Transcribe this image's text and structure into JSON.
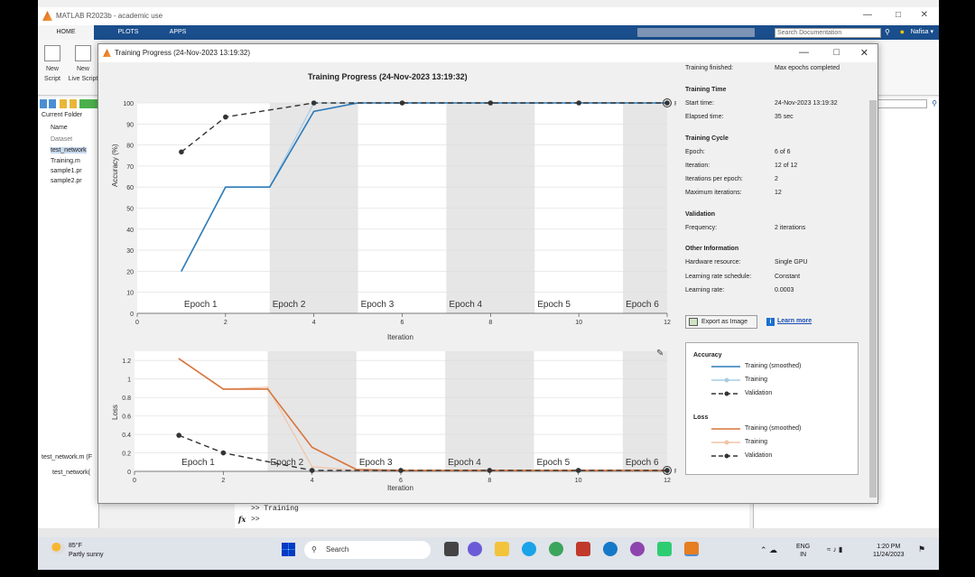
{
  "matlab": {
    "window_title": "MATLAB R2023b - academic use",
    "ribbon_tabs": [
      "HOME",
      "PLOTS",
      "APPS"
    ],
    "search_placeholder": "Search Documentation",
    "user": "Nafisa ▾",
    "new_script": "New",
    "new_script_2": "Script",
    "new_live": "New",
    "new_live_2": "Live Script",
    "current_folder": "Current Folder",
    "folder_name_header": "Name",
    "files": [
      "Dataset",
      "test_network",
      "Training.m",
      "sample1.pr",
      "sample2.pr"
    ],
    "details_file": "test_network.m  (F",
    "details_item": "test_network(",
    "command_line_1": ">> Training",
    "command_prompt": ">>",
    "fx": "fx"
  },
  "training": {
    "window_title": "Training Progress (24-Nov-2023 13:19:32)",
    "plot_title": "Training Progress (24-Nov-2023 13:19:32)",
    "acc_ylabel": "Accuracy (%)",
    "loss_ylabel": "Loss",
    "xlabel": "Iteration",
    "final_label": "Final",
    "epoch_labels": [
      "Epoch 1",
      "Epoch 2",
      "Epoch 3",
      "Epoch 4",
      "Epoch 5",
      "Epoch 6"
    ],
    "info": {
      "finished_label": "Training finished:",
      "finished_value": "Max epochs completed",
      "time_header": "Training Time",
      "start_label": "Start time:",
      "start_value": "24-Nov-2023 13:19:32",
      "elapsed_label": "Elapsed time:",
      "elapsed_value": "35 sec",
      "cycle_header": "Training Cycle",
      "epoch_label": "Epoch:",
      "epoch_value": "6 of 6",
      "iteration_label": "Iteration:",
      "iteration_value": "12 of 12",
      "ipe_label": "Iterations per epoch:",
      "ipe_value": "2",
      "maxit_label": "Maximum iterations:",
      "maxit_value": "12",
      "validation_header": "Validation",
      "freq_label": "Frequency:",
      "freq_value": "2 iterations",
      "other_header": "Other Information",
      "hw_label": "Hardware resource:",
      "hw_value": "Single GPU",
      "lrs_label": "Learning rate schedule:",
      "lrs_value": "Constant",
      "lr_label": "Learning rate:",
      "lr_value": "0.0003"
    },
    "export_label": "Export as Image",
    "learn_more": "Learn more",
    "legend": {
      "acc_header": "Accuracy",
      "loss_header": "Loss",
      "smoothed": "Training (smoothed)",
      "training": "Training",
      "validation": "Validation"
    }
  },
  "chart_data": [
    {
      "type": "line",
      "ylabel": "Accuracy (%)",
      "xlabel": "Iteration",
      "xlim": [
        0,
        12
      ],
      "ylim": [
        0,
        100
      ],
      "xticks": [
        0,
        2,
        4,
        6,
        8,
        10,
        12
      ],
      "yticks": [
        0,
        10,
        20,
        30,
        40,
        50,
        60,
        70,
        80,
        90,
        100
      ],
      "series": [
        {
          "name": "Training (smoothed)",
          "color": "#2b7bba",
          "x": [
            1,
            2,
            3,
            4,
            5,
            6,
            7,
            8,
            9,
            10,
            11,
            12
          ],
          "values": [
            20,
            60,
            60,
            96,
            100,
            100,
            100,
            100,
            100,
            100,
            100,
            100
          ]
        },
        {
          "name": "Training",
          "color": "#a9cbe4",
          "x": [
            1,
            2,
            3,
            4,
            5,
            6,
            7,
            8,
            9,
            10,
            11,
            12
          ],
          "values": [
            20,
            60,
            60,
            100,
            100,
            100,
            100,
            100,
            100,
            100,
            100,
            100
          ]
        },
        {
          "name": "Validation",
          "color": "#333333",
          "x": [
            1,
            2,
            4,
            6,
            8,
            10,
            12
          ],
          "values": [
            76.7,
            93.3,
            100,
            100,
            100,
            100,
            100
          ]
        }
      ]
    },
    {
      "type": "line",
      "ylabel": "Loss",
      "xlabel": "Iteration",
      "xlim": [
        0,
        12
      ],
      "ylim": [
        0,
        1.3
      ],
      "xticks": [
        0,
        2,
        4,
        6,
        8,
        10,
        12
      ],
      "yticks": [
        0,
        0.2,
        0.4,
        0.6,
        0.8,
        1,
        1.2
      ],
      "series": [
        {
          "name": "Training (smoothed)",
          "color": "#d9743c",
          "x": [
            1,
            2,
            3,
            4,
            5,
            6,
            7,
            8,
            9,
            10,
            11,
            12
          ],
          "values": [
            1.22,
            0.89,
            0.89,
            0.26,
            0.02,
            0.01,
            0.01,
            0.01,
            0.01,
            0.01,
            0.01,
            0.01
          ]
        },
        {
          "name": "Training",
          "color": "#f0c4a8",
          "x": [
            1,
            2,
            3,
            4,
            5,
            6,
            7,
            8,
            9,
            10,
            11,
            12
          ],
          "values": [
            1.22,
            0.89,
            0.91,
            0.05,
            0.01,
            0.01,
            0.01,
            0.01,
            0.01,
            0.01,
            0.01,
            0.01
          ]
        },
        {
          "name": "Validation",
          "color": "#333333",
          "x": [
            1,
            2,
            4,
            6,
            8,
            10,
            12
          ],
          "values": [
            0.39,
            0.2,
            0.01,
            0.01,
            0.01,
            0.01,
            0.01
          ]
        }
      ]
    }
  ],
  "taskbar": {
    "temp": "85°F",
    "weather": "Partly sunny",
    "search": "Search",
    "lang": "ENG",
    "region": "IN",
    "time": "1:20 PM",
    "date": "11/24/2023"
  }
}
